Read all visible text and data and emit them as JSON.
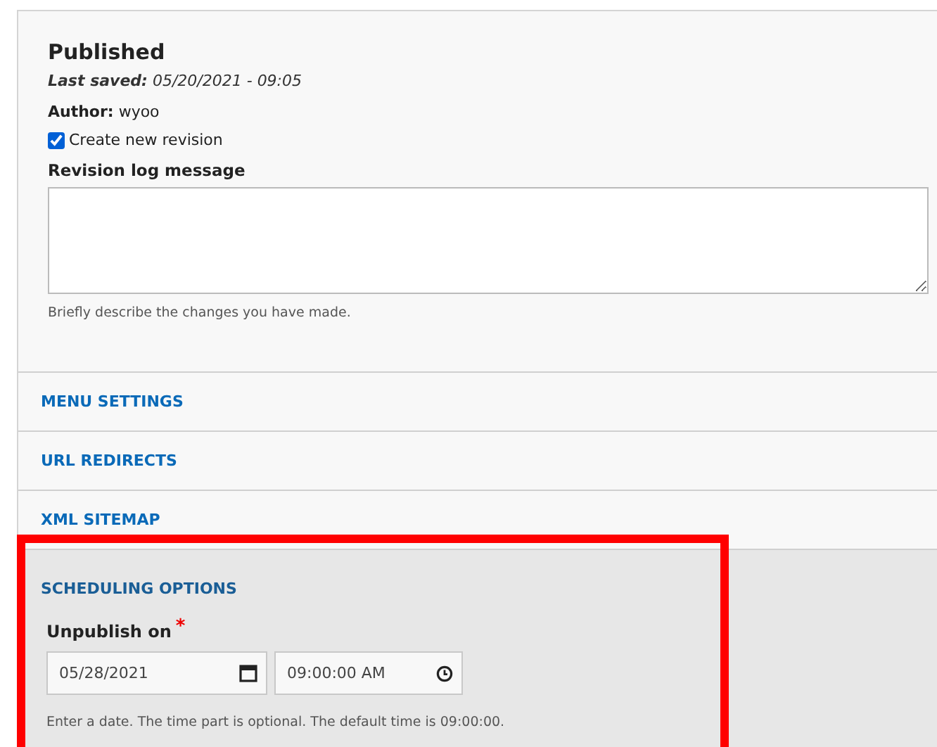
{
  "status": {
    "title": "Published",
    "last_saved_label": "Last saved:",
    "last_saved_value": "05/20/2021 - 09:05",
    "author_label": "Author:",
    "author_value": "wyoo"
  },
  "revision": {
    "checkbox_label": "Create new revision",
    "checked": true,
    "log_label": "Revision log message",
    "description": "Briefly describe the changes you have made."
  },
  "sections": [
    {
      "title": "MENU SETTINGS"
    },
    {
      "title": "URL REDIRECTS"
    },
    {
      "title": "XML SITEMAP"
    }
  ],
  "scheduling": {
    "title": "SCHEDULING OPTIONS",
    "field_label": "Unpublish on",
    "required": true,
    "required_mark": "*",
    "date_value": "05/28/2021",
    "time_value": "09:00:00 AM",
    "description": "Enter a date. The time part is optional. The default time is 09:00:00.",
    "highlighted": true
  }
}
